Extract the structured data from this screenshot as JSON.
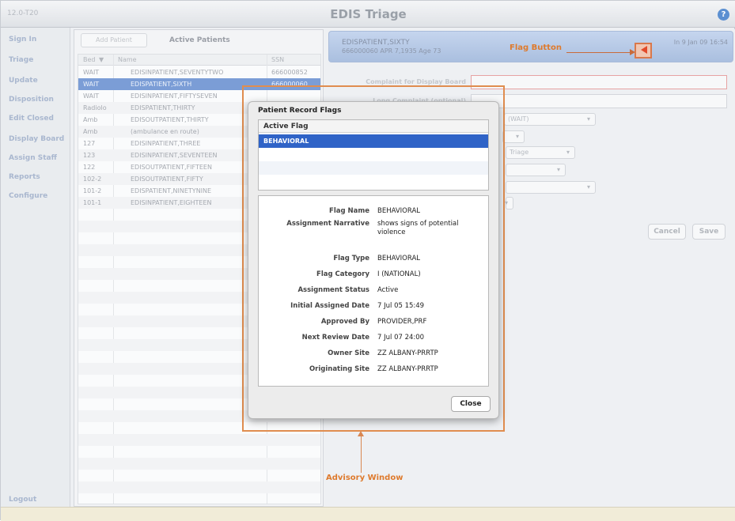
{
  "window": {
    "version": "12.0-T20",
    "title": "EDIS Triage",
    "help_icon": "help-circle-icon"
  },
  "nav": {
    "items": [
      "Sign In",
      "Triage",
      "Update",
      "Disposition",
      "Edit Closed",
      "Display Board",
      "Assign Staff",
      "Reports",
      "Configure"
    ],
    "logout": "Logout"
  },
  "patient_list": {
    "add_button": "Add Patient",
    "title": "Active Patients",
    "columns": [
      "Bed",
      "Name",
      "SSN"
    ],
    "sort_indicator": "▼",
    "rows": [
      {
        "bed": "WAIT",
        "name": "EDISINPATIENT,SEVENTYTWO",
        "ssn": "666000852"
      },
      {
        "bed": "WAIT",
        "name": "EDISPATIENT,SIXTH",
        "ssn": "666000060"
      },
      {
        "bed": "WAIT",
        "name": "EDISINPATIENT,FIFTYSEVEN",
        "ssn": ""
      },
      {
        "bed": "Radiolo",
        "name": "EDISPATIENT,THIRTY",
        "ssn": ""
      },
      {
        "bed": "Amb",
        "name": "EDISOUTPATIENT,THIRTY",
        "ssn": ""
      },
      {
        "bed": "Amb",
        "name": "(ambulance en route)",
        "ssn": ""
      },
      {
        "bed": "127",
        "name": "EDISINPATIENT,THREE",
        "ssn": ""
      },
      {
        "bed": "123",
        "name": "EDISINPATIENT,SEVENTEEN",
        "ssn": ""
      },
      {
        "bed": "122",
        "name": "EDISOUTPATIENT,FIFTEEN",
        "ssn": ""
      },
      {
        "bed": "102-2",
        "name": "EDISOUTPATIENT,FIFTY",
        "ssn": ""
      },
      {
        "bed": "101-2",
        "name": "EDISPATIENT,NINETYNINE",
        "ssn": ""
      },
      {
        "bed": "101-1",
        "name": "EDISINPATIENT,EIGHTEEN",
        "ssn": ""
      }
    ],
    "selected_index": 1
  },
  "patient_banner": {
    "name": "EDISPATIENT,SIXTY",
    "info": "666000060   APR 7,1935   Age 73",
    "date": "In 9 Jan 09 16:54"
  },
  "annotations": {
    "flag_button": "Flag Button",
    "advisory_window": "Advisory Window"
  },
  "form": {
    "complaint_label": "Complaint for Display Board",
    "long_complaint_label": "Long Complaint (optional)",
    "status_select": "(WAIT)",
    "triage_select": "Triage",
    "cancel": "Cancel",
    "save": "Save"
  },
  "modal": {
    "title": "Patient Record Flags",
    "list_header": "Active Flag",
    "flags": [
      "BEHAVIORAL"
    ],
    "fields": [
      {
        "label": "Flag Name",
        "value": "BEHAVIORAL"
      },
      {
        "label": "Assignment Narrative",
        "value": "shows signs of potential violence"
      },
      {
        "label": "Flag Type",
        "value": "BEHAVIORAL"
      },
      {
        "label": "Flag Category",
        "value": "I (NATIONAL)"
      },
      {
        "label": "Assignment Status",
        "value": "Active"
      },
      {
        "label": "Initial Assigned Date",
        "value": "7 Jul 05 15:49"
      },
      {
        "label": "Approved By",
        "value": "PROVIDER,PRF"
      },
      {
        "label": "Next Review Date",
        "value": "7 Jul 07 24:00"
      },
      {
        "label": "Owner Site",
        "value": "ZZ ALBANY-PRRTP"
      },
      {
        "label": "Originating Site",
        "value": "ZZ ALBANY-PRRTP"
      }
    ],
    "close": "Close"
  },
  "colors": {
    "selection": "#2f63c7",
    "callout": "#de7a2d",
    "flag": "#e24a2a"
  }
}
